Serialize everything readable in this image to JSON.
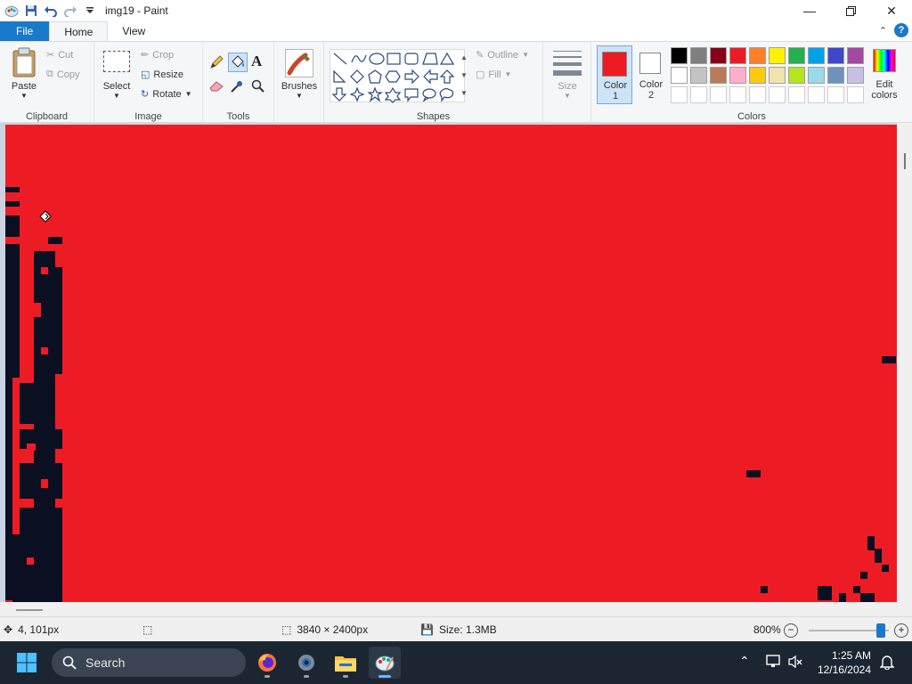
{
  "window": {
    "title": "img19 - Paint"
  },
  "tabs": [
    {
      "label": "File"
    },
    {
      "label": "Home"
    },
    {
      "label": "View"
    }
  ],
  "ribbon": {
    "clipboard": {
      "label": "Clipboard",
      "paste": "Paste",
      "cut": "Cut",
      "copy": "Copy"
    },
    "image": {
      "label": "Image",
      "select": "Select",
      "crop": "Crop",
      "resize": "Resize",
      "rotate": "Rotate"
    },
    "tools": {
      "label": "Tools"
    },
    "brushes": {
      "label": "Brushes"
    },
    "shapes": {
      "label": "Shapes",
      "outline": "Outline",
      "fill": "Fill"
    },
    "size": {
      "label": "Size"
    },
    "color1": {
      "label": "Color",
      "num": "1",
      "value": "#ed1c24"
    },
    "color2": {
      "label": "Color",
      "num": "2",
      "value": "#ffffff"
    },
    "colors": {
      "label": "Colors",
      "edit": "Edit",
      "edit2": "colors"
    },
    "palette_row1": [
      "#000000",
      "#7f7f7f",
      "#880015",
      "#ed1c24",
      "#ff7f27",
      "#fff200",
      "#22b14c",
      "#00a2e8",
      "#3f48cc",
      "#a349a4"
    ],
    "palette_row2": [
      "#ffffff",
      "#c3c3c3",
      "#b97a57",
      "#ffaec9",
      "#ffc90e",
      "#efe4b0",
      "#b5e61d",
      "#99d9ea",
      "#7092be",
      "#c8bfe7"
    ],
    "palette_row3": [
      "#ffffff",
      "#ffffff",
      "#ffffff",
      "#ffffff",
      "#ffffff",
      "#ffffff",
      "#ffffff",
      "#ffffff",
      "#ffffff",
      "#ffffff"
    ]
  },
  "status": {
    "cursor_pos": "4, 101px",
    "image_dims": "3840 × 2400px",
    "file_size": "Size: 1.3MB",
    "zoom": "800%",
    "zoom_level": 0.9
  },
  "taskbar": {
    "search_placeholder": "Search",
    "time": "1:25 AM",
    "date": "12/16/2024"
  }
}
